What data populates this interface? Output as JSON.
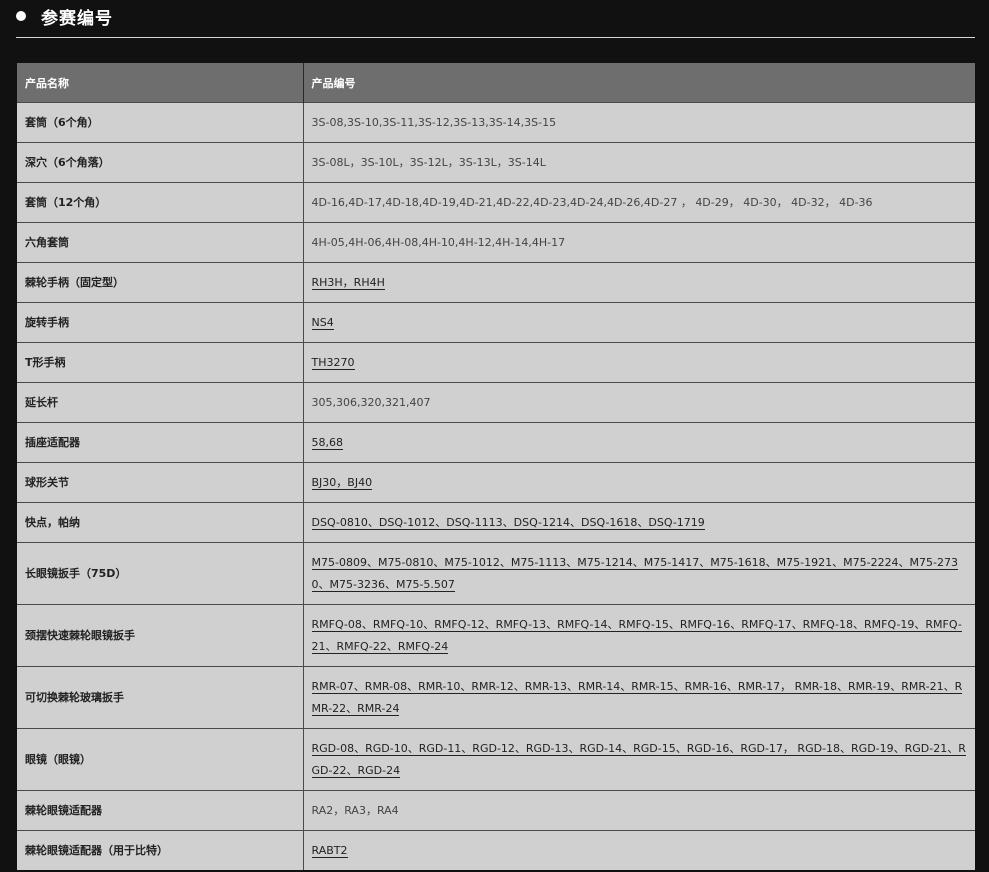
{
  "header": {
    "title": "参赛编号"
  },
  "table": {
    "columns": [
      "产品名称",
      "产品编号"
    ],
    "rows": [
      {
        "name": "套筒（6个角）",
        "codes": "3S-08,3S-10,3S-11,3S-12,3S-13,3S-14,3S-15",
        "linked": false
      },
      {
        "name": "深穴（6个角落）",
        "codes": "3S-08L，3S-10L，3S-12L，3S-13L，3S-14L",
        "linked": false
      },
      {
        "name": "套筒（12个角）",
        "codes": "4D-16,4D-17,4D-18,4D-19,4D-21,4D-22,4D-23,4D-24,4D-26,4D-27 ， 4D-29， 4D-30， 4D-32， 4D-36",
        "linked": false
      },
      {
        "name": "六角套筒",
        "codes": "4H-05,4H-06,4H-08,4H-10,4H-12,4H-14,4H-17",
        "linked": false
      },
      {
        "name": "棘轮手柄（固定型）",
        "codes": "RH3H，RH4H",
        "linked": true
      },
      {
        "name": "旋转手柄",
        "codes": "NS4",
        "linked": true
      },
      {
        "name": "T形手柄",
        "codes": "TH3270",
        "linked": true
      },
      {
        "name": "延长杆",
        "codes": "305,306,320,321,407",
        "linked": false
      },
      {
        "name": "插座适配器",
        "codes": "58,68",
        "linked": true
      },
      {
        "name": "球形关节",
        "codes": "BJ30，BJ40",
        "linked": true
      },
      {
        "name": "快点，帕纳",
        "codes": "DSQ-0810、DSQ-1012、DSQ-1113、DSQ-1214、DSQ-1618、DSQ-1719",
        "linked": true
      },
      {
        "name": "长眼镜扳手（75D）",
        "codes": "M75-0809、M75-0810、M75-1012、M75-1113、M75-1214、M75-1417、M75-1618、M75-1921、M75-2224、M75-2730、M75-3236、M75-5.507",
        "linked": true
      },
      {
        "name": "颈摆快速棘轮眼镜扳手",
        "codes": "RMFQ-08、RMFQ-10、RMFQ-12、RMFQ-13、RMFQ-14、RMFQ-15、RMFQ-16、RMFQ-17、RMFQ-18、RMFQ-19、RMFQ-21、RMFQ-22、RMFQ-24",
        "linked": true
      },
      {
        "name": "可切换棘轮玻璃扳手",
        "codes": "RMR-07、RMR-08、RMR-10、RMR-12、RMR-13、RMR-14、RMR-15、RMR-16、RMR-17， RMR-18、RMR-19、RMR-21、RMR-22、RMR-24",
        "linked": true
      },
      {
        "name": "眼镜（眼镜）",
        "codes": "RGD-08、RGD-10、RGD-11、RGD-12、RGD-13、RGD-14、RGD-15、RGD-16、RGD-17， RGD-18、RGD-19、RGD-21、RGD-22、RGD-24",
        "linked": true
      },
      {
        "name": "棘轮眼镜适配器",
        "codes": "RA2，RA3，RA4",
        "linked": false
      },
      {
        "name": "棘轮眼镜适配器（用于比特）",
        "codes": "RABT2",
        "linked": true
      }
    ]
  }
}
